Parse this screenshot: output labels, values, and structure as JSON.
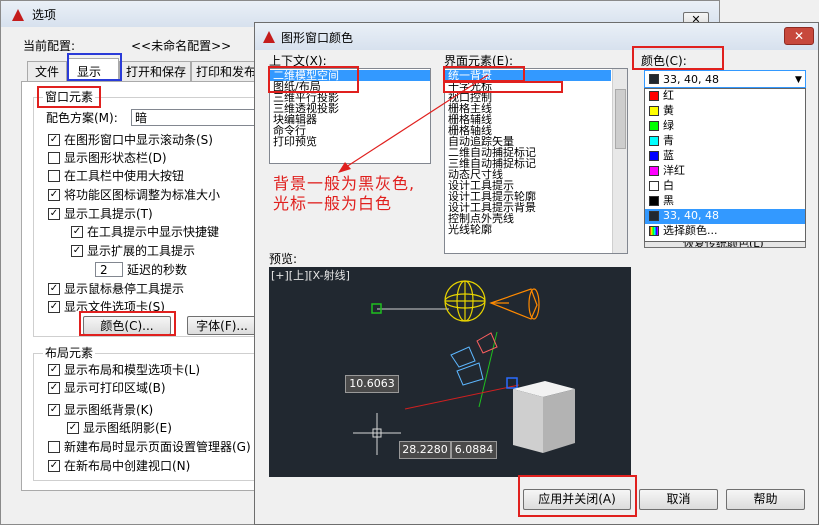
{
  "options": {
    "title": "选项",
    "current_config_label": "当前配置:",
    "current_config_value": "<<未命名配置>>",
    "tabs": [
      "文件",
      "显示",
      "打开和保存",
      "打印和发布"
    ],
    "window_elements_title": "窗口元素",
    "color_scheme_label": "配色方案(M):",
    "color_scheme_value": "暗",
    "checkboxes": [
      {
        "label": "在图形窗口中显示滚动条(S)",
        "checked": true
      },
      {
        "label": "显示图形状态栏(D)",
        "checked": false
      },
      {
        "label": "在工具栏中使用大按钮",
        "checked": false
      },
      {
        "label": "将功能区图标调整为标准大小",
        "checked": true
      },
      {
        "label": "显示工具提示(T)",
        "checked": true
      },
      {
        "label": "在工具提示中显示快捷键",
        "checked": true
      },
      {
        "label": "显示扩展的工具提示",
        "checked": true
      },
      {
        "label": "显示鼠标悬停工具提示",
        "checked": true
      },
      {
        "label": "显示文件选项卡(S)",
        "checked": true
      }
    ],
    "delay_value": "2",
    "delay_label": "延迟的秒数",
    "color_button": "颜色(C)...",
    "font_button": "字体(F)...",
    "layout_title": "布局元素",
    "layout_checkboxes": [
      {
        "label": "显示布局和模型选项卡(L)",
        "checked": true
      },
      {
        "label": "显示可打印区域(B)",
        "checked": true
      },
      {
        "label": "显示图纸背景(K)",
        "checked": true
      },
      {
        "label": "显示图纸阴影(E)",
        "checked": true
      },
      {
        "label": "新建布局时显示页面设置管理器(G)",
        "checked": false
      },
      {
        "label": "在新布局中创建视口(N)",
        "checked": true
      }
    ]
  },
  "dialog": {
    "title": "图形窗口颜色",
    "context_label": "上下文(X):",
    "context_items": [
      "二维模型空间",
      "图纸/布局",
      "三维平行投影",
      "三维透视投影",
      "块编辑器",
      "命令行",
      "打印预览"
    ],
    "interface_label": "界面元素(E):",
    "interface_items": [
      "统一背景",
      "十字光标",
      "视口控制",
      "栅格主线",
      "栅格辅线",
      "栅格轴线",
      "自动追踪矢量",
      "二维自动捕捉标记",
      "三维自动捕捉标记",
      "动态尺寸线",
      "设计工具提示",
      "设计工具提示轮廓",
      "设计工具提示背景",
      "控制点外壳线",
      "光线轮廓"
    ],
    "color_label": "颜色(C):",
    "color_value": "33, 40, 48",
    "color_options": [
      {
        "label": "红",
        "swatch": "#ff0000"
      },
      {
        "label": "黄",
        "swatch": "#ffff00"
      },
      {
        "label": "绿",
        "swatch": "#00ff00"
      },
      {
        "label": "青",
        "swatch": "#00ffff"
      },
      {
        "label": "蓝",
        "swatch": "#0000ff"
      },
      {
        "label": "洋红",
        "swatch": "#ff00ff"
      },
      {
        "label": "白",
        "swatch": "#ffffff"
      },
      {
        "label": "黑",
        "swatch": "#000000"
      },
      {
        "label": "33, 40, 48",
        "swatch": "#212830"
      },
      {
        "label": "选择颜色...",
        "swatch": "multicolor"
      }
    ],
    "restore_button": "恢复传统颜色(L)",
    "annotation": "背景一般为黑灰色,\n光标一般为白色",
    "preview_label": "预览:",
    "viewport_label": "[+][上][X-射线]",
    "dim_a": "10.6063",
    "dim_b": "28.2280",
    "dim_c": "6.0884",
    "apply_button": "应用并关闭(A)",
    "cancel_button": "取消",
    "help_button": "帮助"
  },
  "colors": {
    "annotation": "#e0201e",
    "preview_bg": "#212830"
  }
}
